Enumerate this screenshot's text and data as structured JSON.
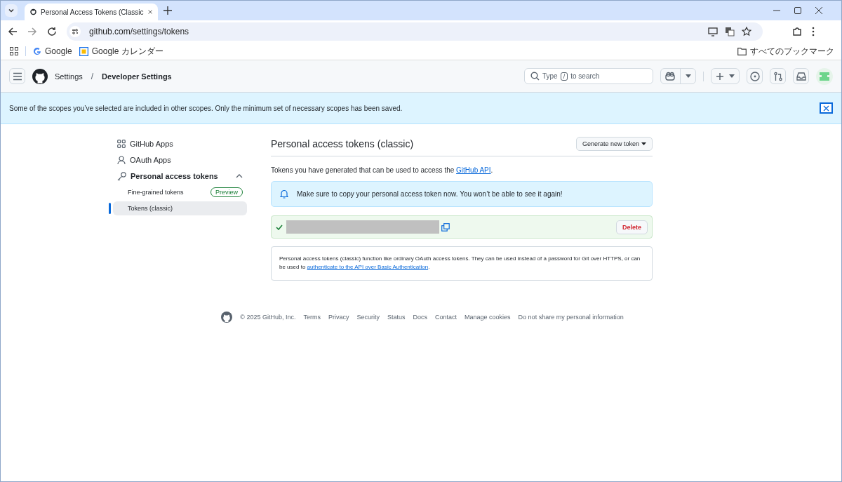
{
  "browser": {
    "tab_title": "Personal Access Tokens (Classic",
    "url": "github.com/settings/tokens",
    "bookmarks": [
      {
        "label": "Google",
        "kind": "google"
      },
      {
        "label": "Google カレンダー",
        "kind": "calendar"
      }
    ],
    "all_bookmarks": "すべてのブックマーク"
  },
  "header": {
    "breadcrumbs": [
      {
        "label": "Settings",
        "current": false
      },
      {
        "label": "Developer Settings",
        "current": true
      }
    ],
    "separator": "/",
    "search": {
      "before": "Type",
      "key": "/",
      "after": "to search"
    }
  },
  "flash": {
    "message": "Some of the scopes you’ve selected are included in other scopes. Only the minimum set of necessary scopes has been saved."
  },
  "sidebar": {
    "items": [
      {
        "label": "GitHub Apps",
        "kind": "apps",
        "selected": false
      },
      {
        "label": "OAuth Apps",
        "kind": "person",
        "selected": false
      },
      {
        "label": "Personal access tokens",
        "kind": "key",
        "selected": false,
        "expanded": true,
        "children": [
          {
            "label": "Fine-grained tokens",
            "badge": "Preview",
            "selected": false
          },
          {
            "label": "Tokens (classic)",
            "selected": true
          }
        ]
      }
    ]
  },
  "main": {
    "title": "Personal access tokens (classic)",
    "generate_button": "Generate new token",
    "intro": {
      "before": "Tokens you have generated that can be used to access the ",
      "link": "GitHub API",
      "after": "."
    },
    "notice": "Make sure to copy your personal access token now. You won’t be able to see it again!",
    "token": {
      "delete_button": "Delete"
    },
    "info": {
      "before": "Personal access tokens (classic) function like ordinary OAuth access tokens. They can be used instead of a password for Git over HTTPS, or can be used to ",
      "link": "authenticate to the API over Basic Authentication",
      "after": "."
    }
  },
  "footer": {
    "copyright": "© 2025 GitHub, Inc.",
    "links": [
      "Terms",
      "Privacy",
      "Security",
      "Status",
      "Docs",
      "Contact",
      "Manage cookies",
      "Do not share my personal information"
    ]
  }
}
